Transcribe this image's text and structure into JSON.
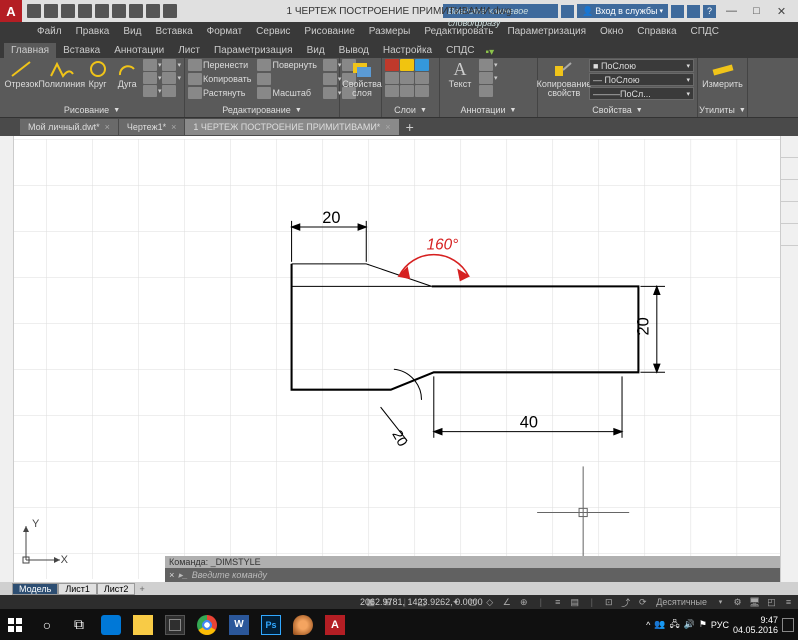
{
  "title": "1 ЧЕРТЕЖ ПОСТРОЕНИЕ ПРИМИТИВАМИ.dwg",
  "search_placeholder": "Введите ключевое слово/фразу",
  "login_label": "Вход в службы",
  "menu": [
    "Файл",
    "Правка",
    "Вид",
    "Вставка",
    "Формат",
    "Сервис",
    "Рисование",
    "Размеры",
    "Редактировать",
    "Параметризация",
    "Окно",
    "Справка",
    "СПДС"
  ],
  "ribbon_tabs": [
    "Главная",
    "Вставка",
    "Аннотации",
    "Лист",
    "Параметризация",
    "Вид",
    "Вывод",
    "Настройка",
    "СПДС"
  ],
  "panels": {
    "draw": {
      "label": "Рисование",
      "items": {
        "otr": "Отрезок",
        "poly": "Полилиния",
        "circle": "Круг",
        "arc": "Дуга"
      }
    },
    "edit": {
      "label": "Редактирование",
      "items": {
        "move": "Перенести",
        "rotate": "Повернуть",
        "copy": "Копировать",
        "scale": "Масштаб",
        "stretch": "Растянуть"
      }
    },
    "props_layer": {
      "label1": "Свойства",
      "label2": "слоя"
    },
    "layers": {
      "label": "Слои"
    },
    "annot": {
      "label": "Аннотации",
      "text": "Текст"
    },
    "props": {
      "label": "Свойства",
      "copyprops": "Копирование свойств",
      "layer": "ПоСлою",
      "layer2": "———ПоСл..."
    },
    "util": {
      "label": "Утилиты",
      "measure": "Измерить"
    }
  },
  "file_tabs": [
    "Мой личный.dwt*",
    "Чертеж1*",
    "1 ЧЕРТЕЖ ПОСТРОЕНИЕ ПРИМИТИВАМИ*"
  ],
  "drawing": {
    "dim_top": "20",
    "dim_right": "20",
    "dim_bottom": "40",
    "dim_diag": "20",
    "angle": "160°"
  },
  "ucs": {
    "x": "X",
    "y": "Y"
  },
  "cmd_hist": "Команда:  _DIMSTYLE",
  "cmd_prompt": "Введите команду",
  "model_tabs": [
    "Модель",
    "Лист1",
    "Лист2"
  ],
  "coords": "2062.9781, 1423.9262, 0.0000",
  "status_units": "Десятичные",
  "tb_lang": "РУС",
  "tb_time": "9:47",
  "tb_date": "04.05.2016"
}
